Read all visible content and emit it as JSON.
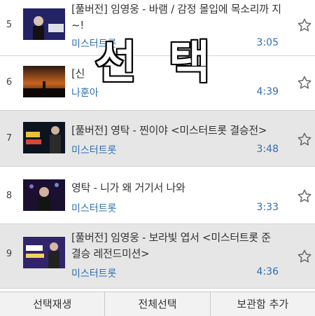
{
  "overlay_text": "선 택",
  "songs": [
    {
      "rank": "5",
      "title": "[풀버전] 임영웅 - 바램 / 감정 몰입에 목소리까 지~!",
      "artist": "미스터트롯",
      "duration": "3:05",
      "thumb_caption": "바램",
      "selected": false
    },
    {
      "rank": "6",
      "title": "[신",
      "artist": "나훈아",
      "duration": "4:39",
      "thumb_caption": "",
      "selected": false
    },
    {
      "rank": "7",
      "title": "[풀버전] 영탁 - 찐이야 <미스터트롯 결승전>",
      "artist": "미스터트롯",
      "duration": "3:48",
      "thumb_caption": "영탁 찐이야",
      "selected": true
    },
    {
      "rank": "8",
      "title": "영탁 - 니가 왜 거기서 나와",
      "artist": "미스터트롯",
      "duration": "3:33",
      "thumb_caption": "",
      "selected": false
    },
    {
      "rank": "9",
      "title": "[풀버전] 임영웅 - 보라빛 엽서 <미스터트롯 준 결승 레전드미션>",
      "artist": "미스터트롯",
      "duration": "4:36",
      "thumb_caption": "임영웅 보랏빛 엽서",
      "selected": true
    }
  ],
  "bottom_bar": {
    "play_selected": "선택재생",
    "select_all": "전체선택",
    "add_to_library": "보관함 추가"
  },
  "colors": {
    "accent_blue": "#2f6fb4",
    "selected_row": "#e6e6e6"
  }
}
